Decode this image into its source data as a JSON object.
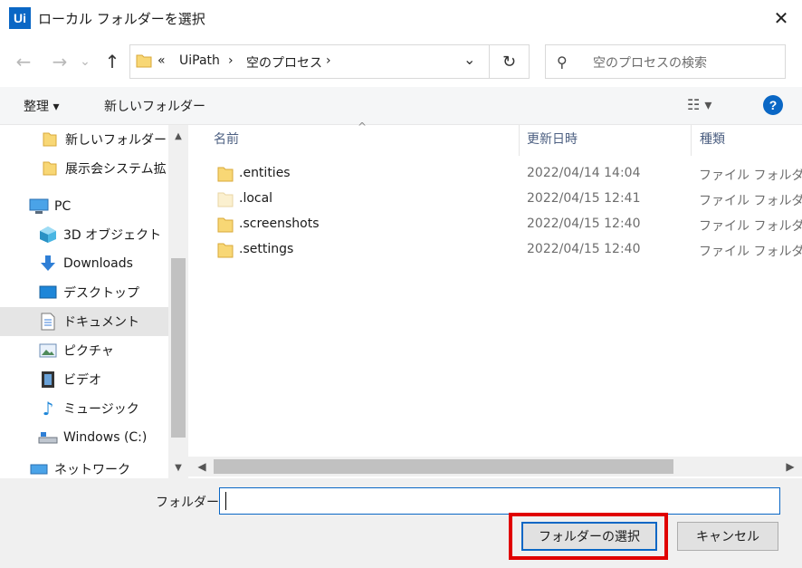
{
  "window": {
    "app_icon": "Ui",
    "title": "ローカル フォルダーを選択",
    "close_glyph": "✕"
  },
  "navigation": {
    "back_icon": "←",
    "forward_icon": "→",
    "recent_icon": "⌄",
    "up_icon": "↑",
    "breadcrumb_overflow": "«",
    "breadcrumbs": [
      "UiPath",
      "空のプロセス"
    ],
    "separator": "›",
    "dropdown_icon": "⌄",
    "refresh_icon": "↻",
    "search_icon": "⚲",
    "search_placeholder": "空のプロセスの検索"
  },
  "toolbar": {
    "organize": "整理 ▾",
    "new_folder": "新しいフォルダー",
    "view_icon": "☷ ▾",
    "help": "?"
  },
  "nav_pane": {
    "items": [
      {
        "label": "新しいフォルダー",
        "icon": "folder-icon"
      },
      {
        "label": "展示会システム拡",
        "icon": "folder-icon"
      },
      {
        "label": "PC",
        "icon": "computer-icon"
      },
      {
        "label": "3D オブジェクト",
        "icon": "cube-icon"
      },
      {
        "label": "Downloads",
        "icon": "download-icon"
      },
      {
        "label": "デスクトップ",
        "icon": "desktop-icon"
      },
      {
        "label": "ドキュメント",
        "icon": "document-icon",
        "selected": true
      },
      {
        "label": "ピクチャ",
        "icon": "picture-icon"
      },
      {
        "label": "ビデオ",
        "icon": "video-icon"
      },
      {
        "label": "ミュージック",
        "icon": "music-icon"
      },
      {
        "label": "Windows (C:)",
        "icon": "drive-icon"
      },
      {
        "label": "ネットワーク",
        "icon": "network-icon"
      }
    ],
    "scroll_up": "▲",
    "scroll_down": "▼"
  },
  "file_list": {
    "columns": {
      "name": "名前",
      "modified": "更新日時",
      "type": "種類"
    },
    "sort_indicator": "^",
    "rows": [
      {
        "name": ".entities",
        "modified": "2022/04/14 14:04",
        "type": "ファイル フォルダー",
        "icon": "folder-icon"
      },
      {
        "name": ".local",
        "modified": "2022/04/15 12:41",
        "type": "ファイル フォルダー",
        "icon": "folder-hidden-icon"
      },
      {
        "name": ".screenshots",
        "modified": "2022/04/15 12:40",
        "type": "ファイル フォルダー",
        "icon": "folder-icon"
      },
      {
        "name": ".settings",
        "modified": "2022/04/15 12:40",
        "type": "ファイル フォルダー",
        "icon": "folder-icon"
      }
    ],
    "scroll_left": "◀",
    "scroll_right": "▶"
  },
  "footer": {
    "folder_label": "フォルダー:",
    "folder_value": "",
    "select_button": "フォルダーの選択",
    "cancel_button": "キャンセル"
  },
  "colors": {
    "accent": "#0a67c5",
    "highlight_frame": "#e00000",
    "folder_yellow": "#f8d775"
  }
}
